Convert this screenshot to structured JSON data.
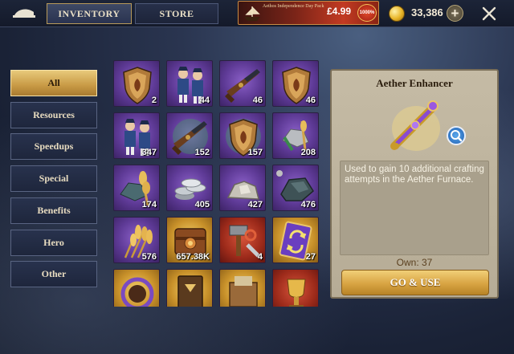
{
  "topbar": {
    "tabs": [
      {
        "label": "INVENTORY",
        "active": true
      },
      {
        "label": "STORE",
        "active": false
      }
    ],
    "promo": {
      "title": "Aethos Independence Day Pack",
      "price": "£4.99",
      "badge": "1000%"
    },
    "currency": {
      "icon": "gold-coin-icon",
      "amount": "33,386"
    },
    "add_icon": "plus-icon",
    "close_icon": "close-icon"
  },
  "categories": [
    {
      "label": "All",
      "active": true
    },
    {
      "label": "Resources",
      "active": false
    },
    {
      "label": "Speedups",
      "active": false
    },
    {
      "label": "Special",
      "active": false
    },
    {
      "label": "Benefits",
      "active": false
    },
    {
      "label": "Hero",
      "active": false
    },
    {
      "label": "Other",
      "active": false
    }
  ],
  "items": [
    {
      "icon": "shield-crest-icon",
      "rarity": "purple",
      "qty": "2"
    },
    {
      "icon": "soldiers-icon",
      "rarity": "purple",
      "qty": "44"
    },
    {
      "icon": "musket-icon",
      "rarity": "purple",
      "qty": "46"
    },
    {
      "icon": "shield-crest-icon",
      "rarity": "purple",
      "qty": "46"
    },
    {
      "icon": "soldiers-icon",
      "rarity": "purple",
      "qty": "347"
    },
    {
      "icon": "musket-icon",
      "rarity": "purple",
      "qty": "152"
    },
    {
      "icon": "shield-crest-icon",
      "rarity": "purple",
      "qty": "157"
    },
    {
      "icon": "stone-wheat-icon",
      "rarity": "purple",
      "qty": "208"
    },
    {
      "icon": "stone-wheat-icon",
      "rarity": "purple",
      "qty": "174"
    },
    {
      "icon": "silver-coins-icon",
      "rarity": "purple",
      "qty": "405"
    },
    {
      "icon": "stone-pile-icon",
      "rarity": "purple",
      "qty": "427"
    },
    {
      "icon": "iron-ore-icon",
      "rarity": "purple",
      "qty": "476"
    },
    {
      "icon": "wheat-icon",
      "rarity": "purple",
      "qty": "576"
    },
    {
      "icon": "treasure-chest-icon",
      "rarity": "gold",
      "qty": "657.38K"
    },
    {
      "icon": "hammer-tools-icon",
      "rarity": "red",
      "qty": "4"
    },
    {
      "icon": "swap-card-icon",
      "rarity": "gold",
      "qty": "27"
    },
    {
      "icon": "wreath-medal-icon",
      "rarity": "gold",
      "qty": ""
    },
    {
      "icon": "tome-icon",
      "rarity": "gold",
      "qty": ""
    },
    {
      "icon": "supply-crate-icon",
      "rarity": "gold",
      "qty": ""
    },
    {
      "icon": "trophy-icon",
      "rarity": "red",
      "qty": ""
    }
  ],
  "detail": {
    "title": "Aether Enhancer",
    "icon": "aether-flask-icon",
    "zoom_icon": "magnify-icon",
    "description": "Used to gain 10 additional crafting attempts in the Aether Furnace.",
    "own": "Own: 37",
    "action": "GO & USE"
  }
}
